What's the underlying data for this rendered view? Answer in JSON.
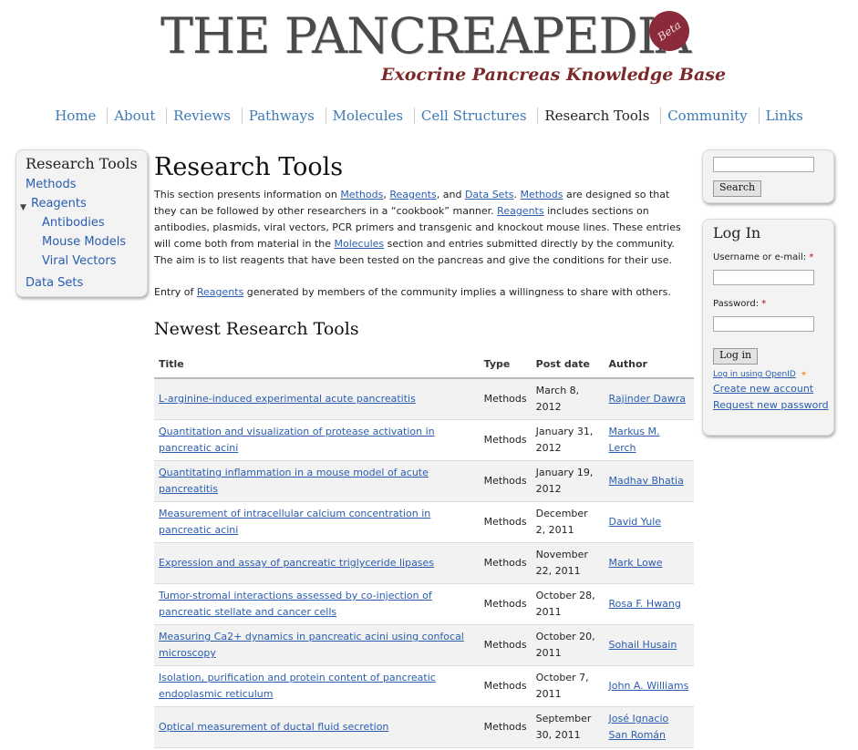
{
  "header": {
    "logo_title": "THE PANCREAPEDIA",
    "logo_subtitle": "Exocrine Pancreas Knowledge Base",
    "beta_label": "Beta"
  },
  "nav": [
    "Home",
    "About",
    "Reviews",
    "Pathways",
    "Molecules",
    "Cell Structures",
    "Research Tools",
    "Community",
    "Links"
  ],
  "nav_active": "Research Tools",
  "sidebar": {
    "title": "Research Tools",
    "items": [
      {
        "label": "Methods"
      },
      {
        "label": "Reagents"
      },
      {
        "label": "Antibodies"
      },
      {
        "label": "Mouse Models"
      },
      {
        "label": "Viral Vectors"
      },
      {
        "label": "Data Sets"
      }
    ]
  },
  "main": {
    "title": "Research Tools",
    "intro": {
      "t1": "This section presents information on ",
      "l_methods": "Methods",
      "t2": ", ",
      "l_reagents": "Reagents",
      "t3": ", and ",
      "l_datasets": "Data Sets",
      "t4": ". ",
      "l_methods2": "Methods",
      "t5": " are designed so that they can be followed by other researchers in a “cookbook” manner. ",
      "l_reagents2": "Reagents",
      "t6": " includes sections on antibodies, plasmids, viral vectors, PCR primers and transgenic and knockout mouse lines. These entries will come both from material in the ",
      "l_molecules": "Molecules",
      "t7": " section and entries submitted directly by the community. The aim is to list reagents that have been tested on the pancreas and give the conditions for their use."
    },
    "entry": {
      "t1": "Entry of ",
      "l_reagents": "Reagents",
      "t2": " generated by members of the community implies a willingness to share with others."
    },
    "newest_heading": "Newest Research Tools",
    "table": {
      "headers": {
        "title": "Title",
        "type": "Type",
        "date": "Post date",
        "author": "Author"
      },
      "rows": [
        {
          "title": "L-arginine-induced experimental acute pancreatitis",
          "type": "Methods",
          "date": "March 8, 2012",
          "author": "Rajinder Dawra"
        },
        {
          "title": "Quantitation and visualization of protease activation in pancreatic acini",
          "type": "Methods",
          "date": "January 31, 2012",
          "author": "Markus M. Lerch"
        },
        {
          "title": "Quantitating inflammation in a mouse model of acute pancreatitis",
          "type": "Methods",
          "date": "January 19, 2012",
          "author": "Madhav Bhatia"
        },
        {
          "title": "Measurement of intracellular calcium concentration in pancreatic acini",
          "type": "Methods",
          "date": "December 2, 2011",
          "author": "David Yule"
        },
        {
          "title": "Expression and assay of pancreatic triglyceride lipases",
          "type": "Methods",
          "date": "November 22, 2011",
          "author": "Mark Lowe"
        },
        {
          "title": "Tumor-stromal interactions assessed by co-injection of pancreatic stellate and cancer cells",
          "type": "Methods",
          "date": "October 28, 2011",
          "author": "Rosa F. Hwang"
        },
        {
          "title": "Measuring Ca2+ dynamics in pancreatic acini using confocal microscopy",
          "type": "Methods",
          "date": "October 20, 2011",
          "author": "Sohail Husain"
        },
        {
          "title": "Isolation, purification and protein content of pancreatic endoplasmic reticulum",
          "type": "Methods",
          "date": "October 7, 2011",
          "author": "John A. Williams"
        },
        {
          "title": "Optical measurement of ductal fluid secretion",
          "type": "Methods",
          "date": "September 30, 2011",
          "author": "José Ignacio San Román"
        }
      ]
    }
  },
  "search": {
    "input_value": "",
    "button_label": "Search"
  },
  "login": {
    "title": "Log In",
    "username_label": "Username or e-mail:",
    "password_label": "Password:",
    "required_mark": "*",
    "button_label": "Log in",
    "openid_link": "Log in using OpenID",
    "create_account": "Create new account",
    "request_password": "Request new password"
  },
  "colors": {
    "link": "#2a5db0",
    "nav_link": "#3c7ab5",
    "required": "#cc0000",
    "beta_badge": "#8a2a3a"
  }
}
